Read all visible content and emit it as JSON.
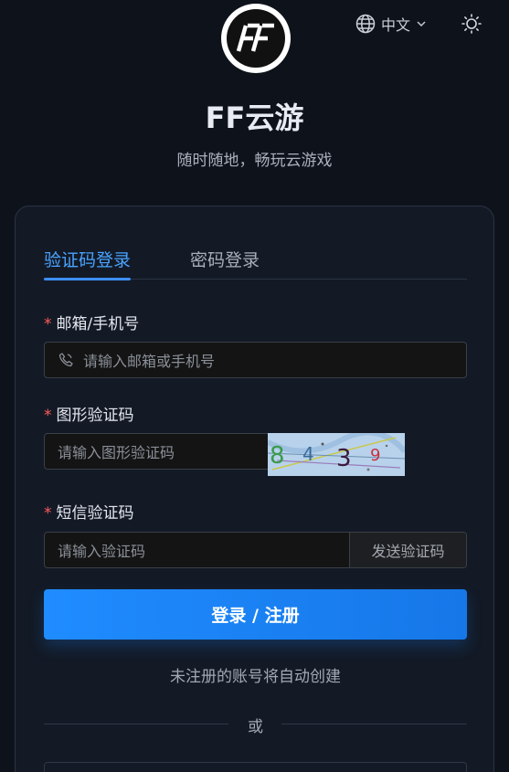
{
  "header": {
    "logo_text": "FF",
    "language_label": "中文"
  },
  "app": {
    "title": "FF云游",
    "slogan": "随时随地，畅玩云游戏"
  },
  "login": {
    "tabs": [
      {
        "label": "验证码登录",
        "active": true
      },
      {
        "label": "密码登录",
        "active": false
      }
    ],
    "account": {
      "label": "邮箱/手机号",
      "placeholder": "请输入邮箱或手机号",
      "value": ""
    },
    "captcha": {
      "label": "图形验证码",
      "placeholder": "请输入图形验证码",
      "value": "",
      "image_text": [
        "8",
        "4",
        "3",
        "9"
      ]
    },
    "sms": {
      "label": "短信验证码",
      "placeholder": "请输入验证码",
      "value": "",
      "send_button": "发送验证码"
    },
    "required_mark": "*",
    "submit_label": "登录 / 注册",
    "auto_create_hint": "未注册的账号将自动创建",
    "or_label": "或"
  },
  "colors": {
    "accent": "#1f8cff",
    "background": "#0e131b",
    "card": "#131a26",
    "required": "#ff5b5b"
  }
}
